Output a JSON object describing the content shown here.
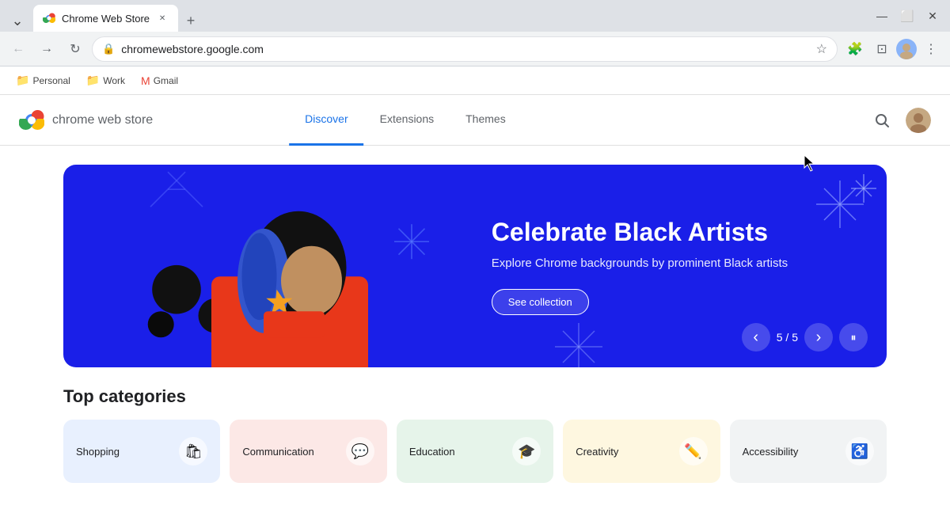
{
  "browser": {
    "tab": {
      "title": "Chrome Web Store",
      "favicon": "🔵"
    },
    "address": "chromewebstore.google.com",
    "window_controls": {
      "minimize": "—",
      "maximize": "⬜",
      "close": "✕"
    }
  },
  "bookmarks": [
    {
      "id": "personal",
      "icon": "📁",
      "label": "Personal"
    },
    {
      "id": "work",
      "icon": "📁",
      "label": "Work"
    },
    {
      "id": "gmail",
      "icon": "✉",
      "label": "Gmail"
    }
  ],
  "cws": {
    "logo_text": "chrome web store",
    "nav": [
      {
        "id": "discover",
        "label": "Discover",
        "active": true
      },
      {
        "id": "extensions",
        "label": "Extensions",
        "active": false
      },
      {
        "id": "themes",
        "label": "Themes",
        "active": false
      }
    ],
    "hero": {
      "title": "Celebrate Black Artists",
      "subtitle": "Explore Chrome backgrounds by prominent Black artists",
      "cta": "See collection",
      "counter": "5 / 5"
    },
    "top_categories_label": "Top categories",
    "categories": [
      {
        "id": "shopping",
        "name": "Shopping",
        "icon": "🛍"
      },
      {
        "id": "communication",
        "name": "Communication",
        "icon": "💬"
      },
      {
        "id": "education",
        "name": "Education",
        "icon": "🎓"
      },
      {
        "id": "creativity",
        "name": "Creativity",
        "icon": "✏️"
      },
      {
        "id": "accessibility",
        "name": "Accessibility",
        "icon": "♿"
      }
    ]
  },
  "icons": {
    "back": "←",
    "forward": "→",
    "refresh": "↻",
    "star": "☆",
    "extensions": "🧩",
    "profile": "👤",
    "more": "⋮",
    "search": "🔍",
    "prev_arrow": "‹",
    "next_arrow": "›",
    "pause": "⏸"
  }
}
